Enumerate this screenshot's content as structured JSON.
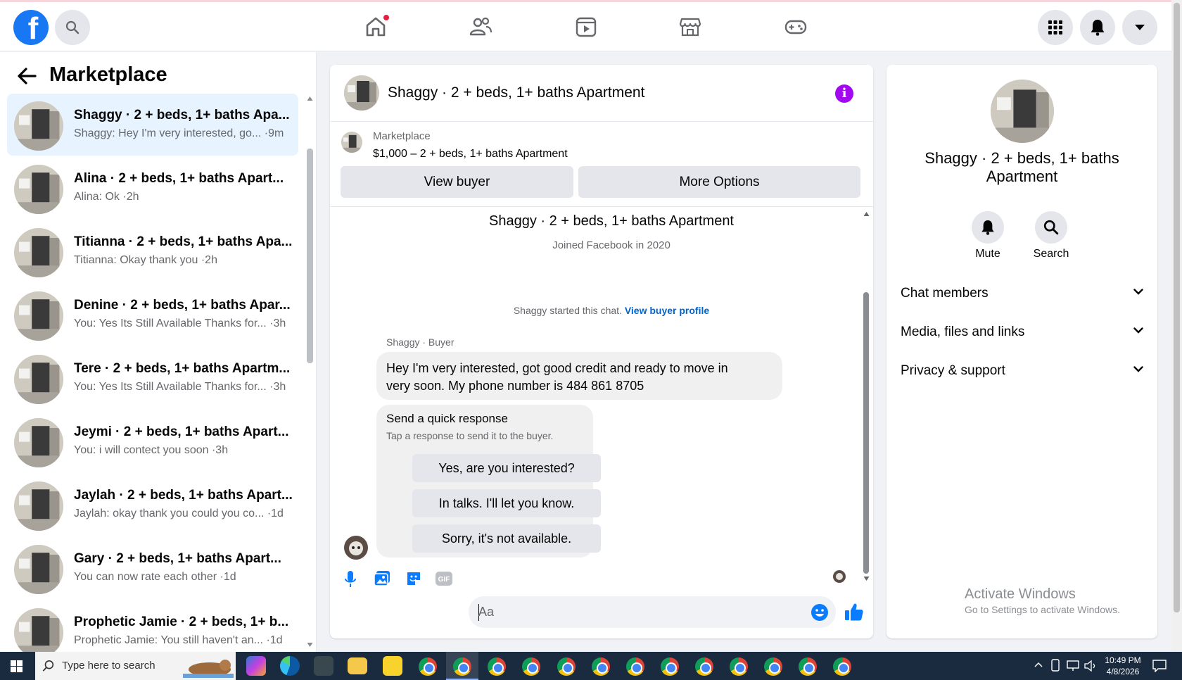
{
  "topbar": {
    "logo": "f",
    "icons": [
      "search-icon",
      "home-icon",
      "friends-icon",
      "watch-icon",
      "marketplace-icon",
      "gaming-icon",
      "menu-grid-icon",
      "bell-icon",
      "account-caret-icon"
    ]
  },
  "left": {
    "title": "Marketplace",
    "conversations": [
      {
        "name": "Shaggy · 2 + beds, 1+ baths Apa...",
        "preview": "Shaggy: Hey I'm very interested, go... ·9m"
      },
      {
        "name": "Alina · 2 + beds, 1+ baths Apart...",
        "preview": "Alina: Ok ·2h"
      },
      {
        "name": "Titianna · 2 + beds, 1+ baths Apa...",
        "preview": "Titianna: Okay thank you ·2h"
      },
      {
        "name": "Denine · 2 + beds, 1+ baths Apar...",
        "preview": "You: Yes Its Still Available Thanks for... ·3h"
      },
      {
        "name": "Tere · 2 + beds, 1+ baths Apartm...",
        "preview": "You: Yes Its Still Available Thanks for... ·3h"
      },
      {
        "name": "Jeymi · 2 + beds, 1+ baths Apart...",
        "preview": "You: i will contect you soon ·3h"
      },
      {
        "name": "Jaylah · 2 + beds, 1+ baths Apart...",
        "preview": "Jaylah: okay thank you could you co... ·1d"
      },
      {
        "name": "Gary · 2 + beds, 1+ baths Apart...",
        "preview": "You can now rate each other ·1d"
      },
      {
        "name": "Prophetic Jamie · 2 + beds, 1+ b...",
        "preview": "Prophetic Jamie: You still haven't an... ·1d"
      }
    ]
  },
  "chat": {
    "title": "Shaggy · 2 + beds, 1+ baths Apartment",
    "marketplace_label": "Marketplace",
    "listing": "$1,000 – 2 + beds, 1+ baths Apartment",
    "view_buyer": "View buyer",
    "more_options": "More Options",
    "profile_name": "Shaggy · 2 + beds, 1+ baths Apartment",
    "joined": "Joined Facebook in 2020",
    "started_text": "Shaggy started this chat.",
    "view_profile_link": "View buyer profile",
    "sender_label": "Shaggy · Buyer",
    "message_line1": "Hey I'm very interested, got good credit and ready to move in",
    "message_line2": "very soon. My phone number is 484 861 8705",
    "quick_title": "Send a quick response",
    "quick_sub": "Tap a response to send it to the buyer.",
    "quick_responses": [
      "Yes, are you interested?",
      "In talks. I'll let you know.",
      "Sorry, it's not available."
    ],
    "composer_placeholder": "Aa",
    "accent": "#0a7cff"
  },
  "right": {
    "title": "Shaggy · 2 + beds, 1+ baths Apartment",
    "mute": "Mute",
    "search": "Search",
    "rows": [
      "Chat members",
      "Media, files and links",
      "Privacy & support"
    ]
  },
  "watermark": {
    "line1": "Activate Windows",
    "line2": "Go to Settings to activate Windows."
  },
  "taskbar": {
    "search_placeholder": "Type here to search",
    "time": "10:49 PM",
    "date": "4/8/2026"
  }
}
